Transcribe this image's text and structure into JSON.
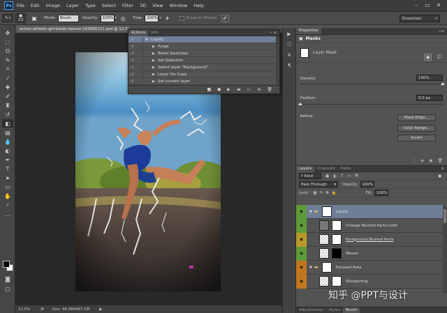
{
  "menubar": {
    "logo": "Ps",
    "items": [
      "File",
      "Edit",
      "Image",
      "Layer",
      "Type",
      "Select",
      "Filter",
      "3D",
      "View",
      "Window",
      "Help"
    ],
    "window_controls": [
      "–",
      "▭",
      "✕"
    ]
  },
  "options": {
    "brush_size": "23",
    "mode_label": "Mode:",
    "mode_value": "Brush",
    "opacity_label": "Opacity:",
    "opacity_value": "100%",
    "flow_label": "Flow:",
    "flow_value": "100%",
    "erase_to_history": "Erase to History",
    "workspace": "Essentials"
  },
  "document": {
    "tab_title": "active-athletic-girl-ballet-dancer-163805111.psd @ 12.5% (Li...",
    "zoom": "12.5%",
    "doc_info": "Doc: 46.9M/497.1M"
  },
  "actions_panel": {
    "tabs": [
      "Actions",
      "Info"
    ],
    "controls": "» ≡",
    "rows": [
      {
        "label": "Liquify",
        "level": 0,
        "expanded": true,
        "selected": true
      },
      {
        "label": "Purge",
        "level": 1,
        "expanded": false,
        "selected": false
      },
      {
        "label": "Reset Swatches",
        "level": 1,
        "expanded": false,
        "selected": false
      },
      {
        "label": "Set Selection",
        "level": 1,
        "expanded": false,
        "selected": false
      },
      {
        "label": "Select layer \"Background\"",
        "level": 1,
        "expanded": false,
        "selected": false
      },
      {
        "label": "Layer Via Copy",
        "level": 1,
        "expanded": false,
        "selected": false
      },
      {
        "label": "Set current layer",
        "level": 1,
        "expanded": false,
        "selected": false
      }
    ],
    "check_glyph": "✓",
    "footer_icons": [
      "■",
      "●",
      "▶",
      "▬",
      "▭",
      "⊕",
      "🗑"
    ]
  },
  "properties": {
    "tab": "Properties",
    "section": "Masks",
    "mask_type": "Layer Mask",
    "density_label": "Density:",
    "density_value": "100%",
    "density_level": 1.0,
    "feather_label": "Feather:",
    "feather_value": "0.0 px",
    "feather_level": 0.0,
    "refine_label": "Refine:",
    "buttons": [
      "Mask Edge...",
      "Color Range...",
      "Invert"
    ]
  },
  "layers_panel": {
    "tabs": [
      "Layers",
      "Channels",
      "Paths"
    ],
    "kind_label": "Kind",
    "blend_mode": "Pass Through",
    "opacity_label": "Opacity:",
    "opacity_value": "100%",
    "lock_label": "Lock:",
    "fill_label": "Fill:",
    "fill_value": "100%",
    "layers": [
      {
        "name": "Liquify",
        "type": "group",
        "eye_color": "#5f9a3a",
        "selected": true
      },
      {
        "name": "Change Blurred Parts Color",
        "type": "adjustment",
        "eye_color": "#5f9a3a",
        "selected": false
      },
      {
        "name": "Foreground Blurred Parts",
        "type": "layer",
        "eye_color": "#b89a2a",
        "selected": false
      },
      {
        "name": "Waves",
        "type": "layer",
        "eye_color": "#5f9a3a",
        "selected": false
      },
      {
        "name": "Focused Area",
        "type": "group",
        "eye_color": "#c0771e",
        "selected": false
      },
      {
        "name": "Sharpening",
        "type": "layer",
        "eye_color": "#c0771e",
        "selected": false
      }
    ]
  },
  "bottom_tabs": [
    "Adjustments",
    "Styles",
    "Brush"
  ],
  "watermark": "知乎 @PPT与设计",
  "colors": {
    "selection": "#6f7f99",
    "ps_blue": "#4aa3ff",
    "panel_bg": "#535353"
  }
}
